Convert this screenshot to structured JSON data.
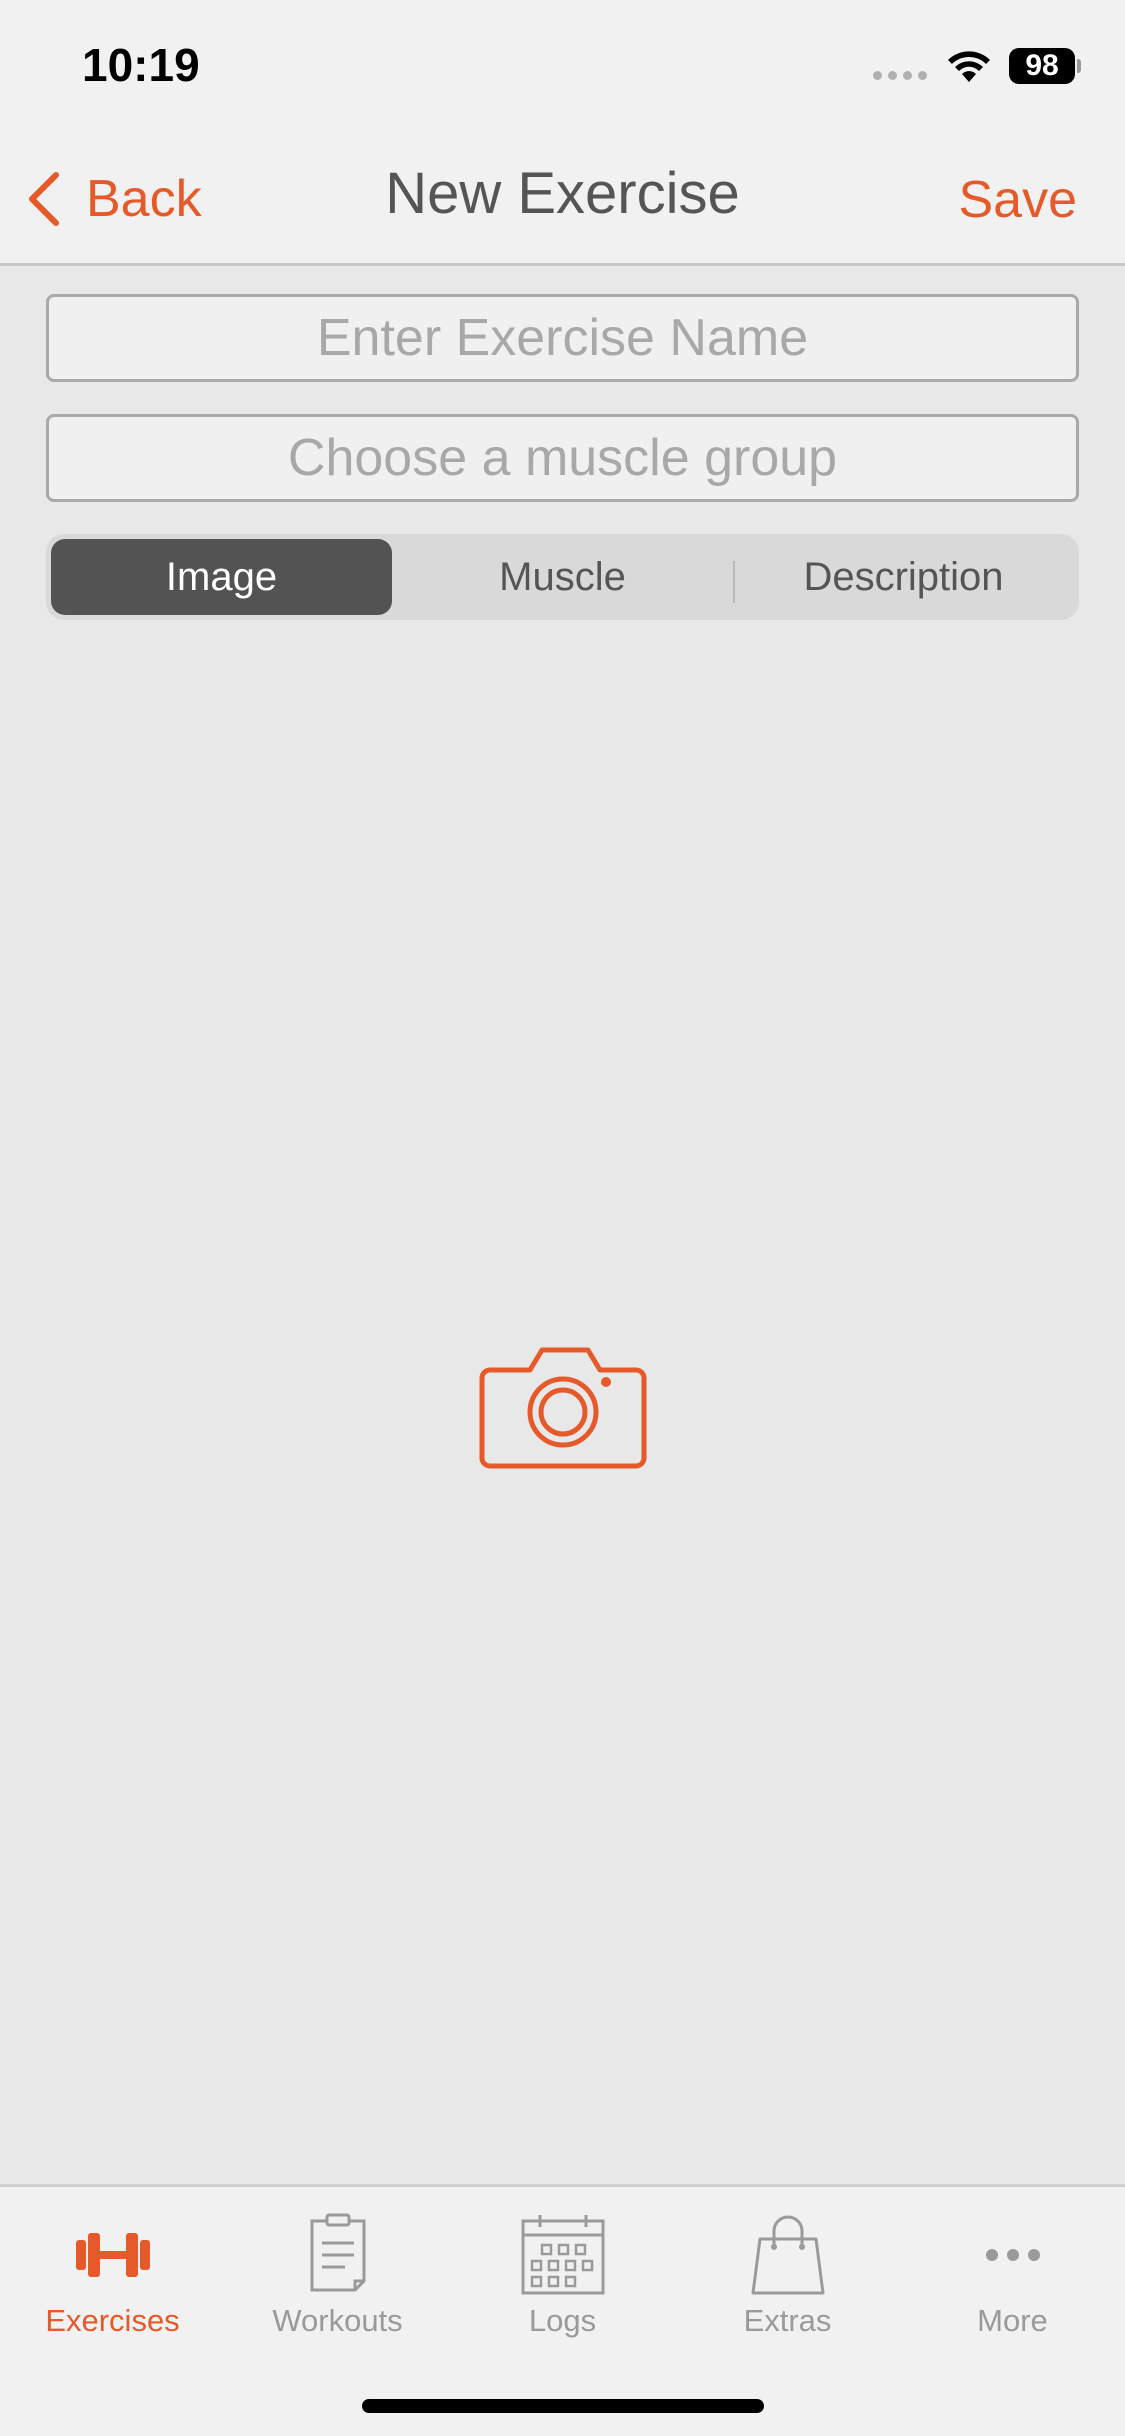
{
  "status_bar": {
    "time": "10:19",
    "battery": "98"
  },
  "nav": {
    "back_label": "Back",
    "title": "New Exercise",
    "save_label": "Save"
  },
  "form": {
    "name_placeholder": "Enter Exercise Name",
    "name_value": "",
    "muscle_placeholder": "Choose a muscle group",
    "muscle_value": ""
  },
  "segments": [
    {
      "label": "Image",
      "selected": true
    },
    {
      "label": "Muscle",
      "selected": false
    },
    {
      "label": "Description",
      "selected": false
    }
  ],
  "tabs": [
    {
      "label": "Exercises",
      "icon": "dumbbell-icon",
      "active": true
    },
    {
      "label": "Workouts",
      "icon": "clipboard-icon",
      "active": false
    },
    {
      "label": "Logs",
      "icon": "calendar-icon",
      "active": false
    },
    {
      "label": "Extras",
      "icon": "shopping-bag-icon",
      "active": false
    },
    {
      "label": "More",
      "icon": "more-dots-icon",
      "active": false
    }
  ],
  "colors": {
    "accent": "#e65a2a",
    "inactive": "#9a9a9a",
    "segment_active": "#535353",
    "background": "#e8e8e8"
  }
}
